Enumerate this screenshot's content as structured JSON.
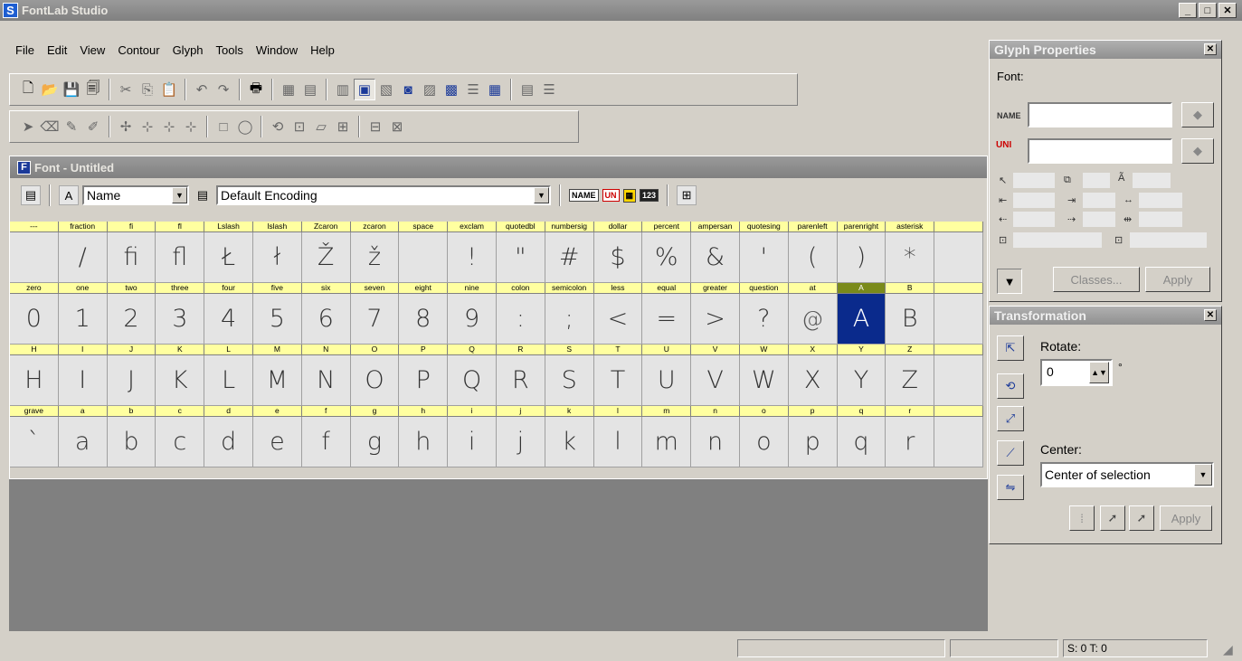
{
  "app": {
    "title": "FontLab Studio",
    "icon": "S",
    "min": "_",
    "max": "□",
    "close": "✕"
  },
  "menu": [
    "File",
    "Edit",
    "View",
    "Contour",
    "Glyph",
    "Tools",
    "Window",
    "Help"
  ],
  "font_window": {
    "title": "Font - Untitled",
    "icon": "F",
    "name_mode": "Name",
    "encoding": "Default Encoding",
    "name_badge": "NAME",
    "uni_badge": "UN",
    "num_badge": "123"
  },
  "glyph_rows": [
    {
      "names": [
        "---",
        "fraction",
        "fi",
        "fl",
        "Lslash",
        "lslash",
        "Zcaron",
        "zcaron",
        "space",
        "exclam",
        "quotedbl",
        "numbersig",
        "dollar",
        "percent",
        "ampersan",
        "quotesing",
        "parenleft",
        "parenright",
        "asterisk"
      ],
      "glyphs": [
        "",
        "/",
        "ﬁ",
        "ﬂ",
        "Ł",
        "ł",
        "Ž",
        "ž",
        "",
        "!",
        "\"",
        "#",
        "$",
        "%",
        "&",
        "'",
        "(",
        ")",
        "*"
      ]
    },
    {
      "names": [
        "zero",
        "one",
        "two",
        "three",
        "four",
        "five",
        "six",
        "seven",
        "eight",
        "nine",
        "colon",
        "semicolon",
        "less",
        "equal",
        "greater",
        "question",
        "at",
        "A",
        "B"
      ],
      "glyphs": [
        "0",
        "1",
        "2",
        "3",
        "4",
        "5",
        "6",
        "7",
        "8",
        "9",
        ":",
        ";",
        "<",
        "=",
        ">",
        "?",
        "@",
        "A",
        "B"
      ]
    },
    {
      "names": [
        "H",
        "I",
        "J",
        "K",
        "L",
        "M",
        "N",
        "O",
        "P",
        "Q",
        "R",
        "S",
        "T",
        "U",
        "V",
        "W",
        "X",
        "Y",
        "Z"
      ],
      "glyphs": [
        "H",
        "I",
        "J",
        "K",
        "L",
        "M",
        "N",
        "O",
        "P",
        "Q",
        "R",
        "S",
        "T",
        "U",
        "V",
        "W",
        "X",
        "Y",
        "Z"
      ]
    },
    {
      "names": [
        "grave",
        "a",
        "b",
        "c",
        "d",
        "e",
        "f",
        "g",
        "h",
        "i",
        "j",
        "k",
        "l",
        "m",
        "n",
        "o",
        "p",
        "q",
        "r"
      ],
      "glyphs": [
        "`",
        "a",
        "b",
        "c",
        "d",
        "e",
        "f",
        "g",
        "h",
        "i",
        "j",
        "k",
        "l",
        "m",
        "n",
        "o",
        "p",
        "q",
        "r"
      ]
    }
  ],
  "selected_glyph": "A",
  "glyph_properties": {
    "title": "Glyph Properties",
    "font_label": "Font:",
    "name_label": "NAME",
    "uni_label": "UNI",
    "classes_button": "Classes...",
    "apply_button": "Apply"
  },
  "transformation": {
    "title": "Transformation",
    "rotate_label": "Rotate:",
    "rotate_value": "0",
    "degree": "°",
    "center_label": "Center:",
    "center_value": "Center of selection",
    "apply_button": "Apply"
  },
  "status": {
    "selection": "S: 0 T: 0"
  },
  "colors": {
    "header_bg": "#ffffa0",
    "selected": "#0a2a8c",
    "title_grey": "#808080"
  }
}
